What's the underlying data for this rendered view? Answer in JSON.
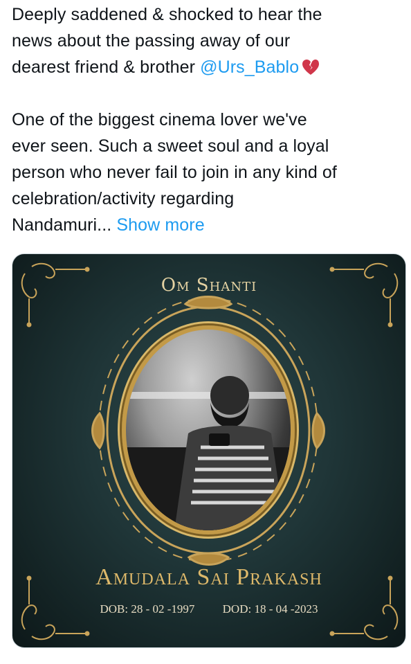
{
  "tweet": {
    "line1": "Deeply saddened & shocked to hear the",
    "line2": "news about the passing away of our",
    "line3_prefix": "dearest friend & brother ",
    "mention": "@Urs_Bablo",
    "emoji_icon": "broken-heart-icon",
    "line4": "One of the biggest cinema lover we've",
    "line5": "ever seen. Such a sweet soul and a loyal",
    "line6": "person who never fail to join in any kind of",
    "line7": "celebration/activity regarding",
    "line8_prefix": "Nandamuri... ",
    "show_more": "Show more"
  },
  "media": {
    "header": "Om Shanti",
    "name": "Amudala Sai Prakash",
    "dob": "DOB: 28 - 02 -1997",
    "dod": "DOD: 18 - 04 -2023"
  },
  "colors": {
    "link": "#1d9bf0",
    "text": "#0f1419",
    "gold": "#ddb86a",
    "card_bg": "#1f3537"
  }
}
